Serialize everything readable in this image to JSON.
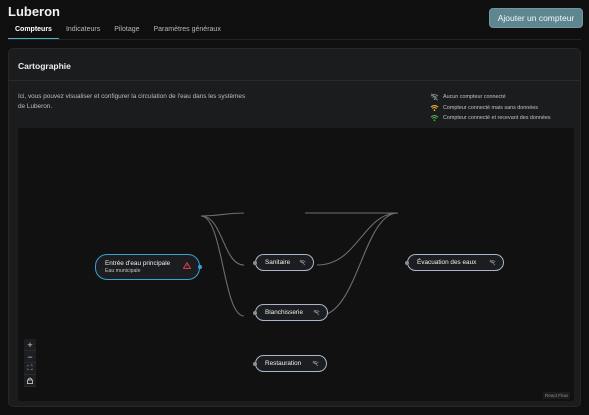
{
  "app": {
    "title": "Luberon"
  },
  "header": {
    "add_button": "Ajouter un compteur"
  },
  "tabs": [
    {
      "label": "Compteurs",
      "active": true
    },
    {
      "label": "Indicateurs",
      "active": false
    },
    {
      "label": "Pilotage",
      "active": false
    },
    {
      "label": "Paramètres généraux",
      "active": false
    }
  ],
  "card": {
    "title": "Cartographie",
    "description": "Ici, vous pouvez visualiser et configurer la circulation de l'eau dans les systèmes de Luberon."
  },
  "legend": {
    "items": [
      {
        "label": "Aucun compteur connecté",
        "color": "#8a8f96",
        "icon": "wifi-off-icon"
      },
      {
        "label": "Compteur connecté mais sans données",
        "color": "#f2b632",
        "icon": "wifi-warning-icon"
      },
      {
        "label": "Compteur connecté et recevant des données",
        "color": "#4caf50",
        "icon": "wifi-ok-icon"
      }
    ]
  },
  "flow": {
    "nodes": {
      "main": {
        "label": "Entrée d'eau principale",
        "sublabel": "Eau municipale",
        "status": "warning-triangle-icon",
        "status_color": "#e0434f"
      },
      "sanitaire": {
        "label": "Sanitaire",
        "status": "wifi-off-icon"
      },
      "blanchisserie": {
        "label": "Blanchisserie",
        "status": "wifi-off-icon"
      },
      "restauration": {
        "label": "Restauration",
        "status": "wifi-off-icon"
      },
      "evacuation": {
        "label": "Évacuation des eaux",
        "status": "wifi-off-icon"
      }
    },
    "controls": [
      "+",
      "−",
      "⛶",
      "🔒"
    ],
    "attribution": "React Flow"
  }
}
